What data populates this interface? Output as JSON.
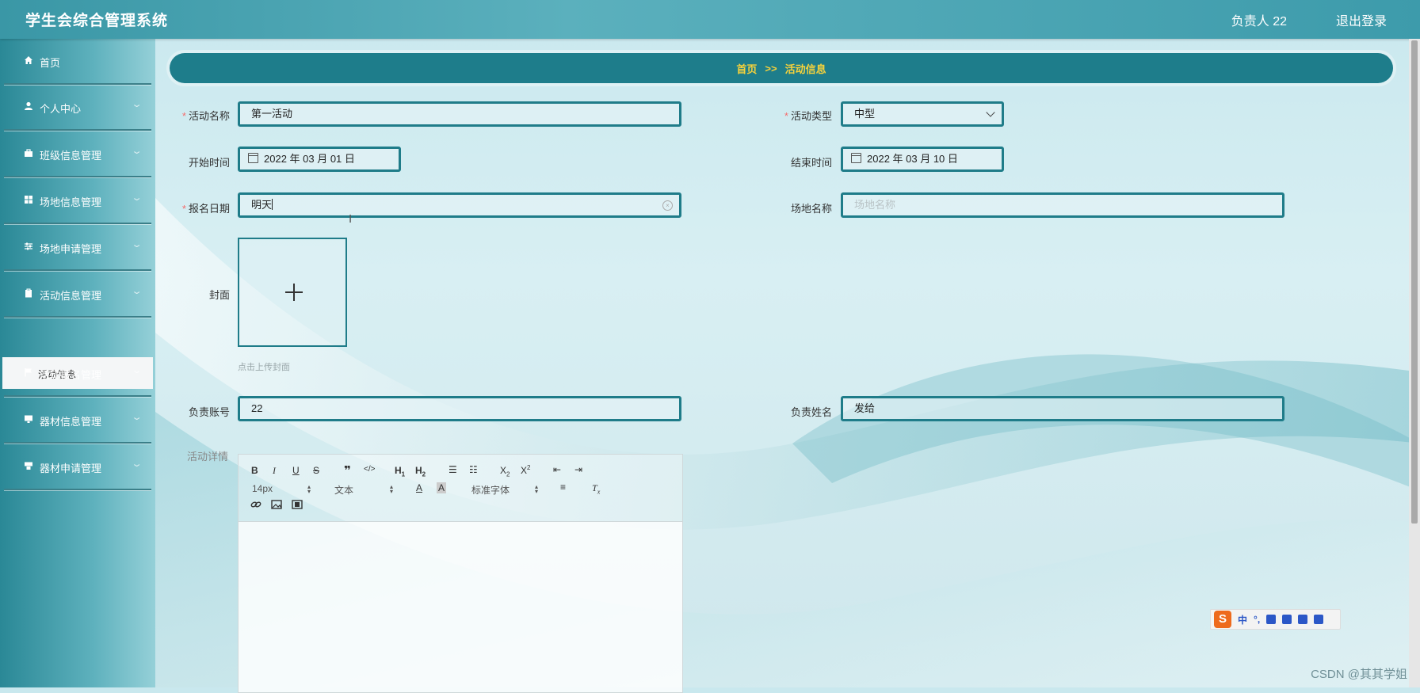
{
  "app": {
    "title": "学生会综合管理系统"
  },
  "header": {
    "user_label": "负责人 22",
    "logout_label": "退出登录"
  },
  "sidebar": {
    "items": [
      {
        "label": "首页",
        "icon": "home-icon",
        "has_arrow": false
      },
      {
        "label": "个人中心",
        "icon": "user-icon",
        "has_arrow": true
      },
      {
        "label": "班级信息管理",
        "icon": "briefcase-icon",
        "has_arrow": true
      },
      {
        "label": "场地信息管理",
        "icon": "grid-icon",
        "has_arrow": true
      },
      {
        "label": "场地申请管理",
        "icon": "sliders-icon",
        "has_arrow": true
      },
      {
        "label": "活动信息管理",
        "icon": "clipboard-icon",
        "has_arrow": true
      },
      {
        "label": "活动报名管理",
        "icon": "flag-icon",
        "has_arrow": true
      },
      {
        "label": "器材信息管理",
        "icon": "monitor-icon",
        "has_arrow": true
      },
      {
        "label": "器材申请管理",
        "icon": "cart-icon",
        "has_arrow": true
      }
    ],
    "active_submenu": "活动信息"
  },
  "breadcrumb": {
    "home": "首页",
    "separator": ">>",
    "current": "活动信息"
  },
  "form": {
    "activity_name": {
      "label": "活动名称",
      "required": true,
      "value": "第一活动"
    },
    "activity_type": {
      "label": "活动类型",
      "required": true,
      "value": "中型"
    },
    "start_time": {
      "label": "开始时间",
      "value": "2022 年 03 月 01 日"
    },
    "end_time": {
      "label": "结束时间",
      "value": "2022 年 03 月 10 日"
    },
    "signup_date": {
      "label": "报名日期",
      "required": true,
      "value": "明天"
    },
    "venue_name": {
      "label": "场地名称",
      "placeholder": "场地名称"
    },
    "cover": {
      "label": "封面",
      "hint": "点击上传封面"
    },
    "owner_account": {
      "label": "负责账号",
      "value": "22"
    },
    "owner_name": {
      "label": "负责姓名",
      "value": "发给"
    },
    "details": {
      "label": "活动详情"
    }
  },
  "editor": {
    "font_size": "14px",
    "header_select": "文本",
    "font_family": "标准字体"
  },
  "ime": {
    "lang": "中",
    "punct": "°,"
  },
  "watermark": "CSDN @其其学姐",
  "colors": {
    "accent": "#1f7c89",
    "breadcrumb_text": "#f6d23b",
    "required": "#f56c6c"
  }
}
